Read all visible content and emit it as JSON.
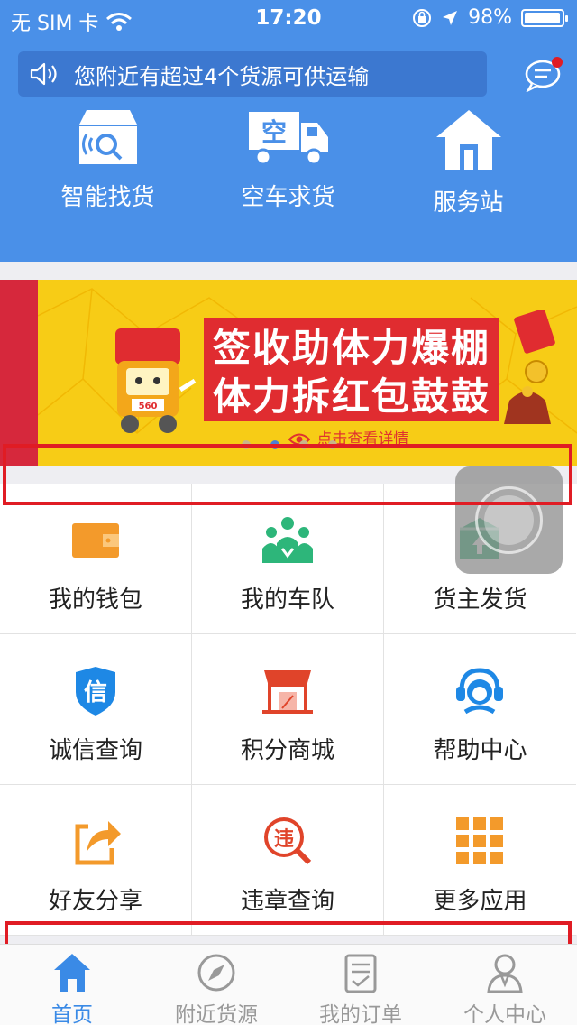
{
  "status_bar": {
    "carrier": "无 SIM 卡",
    "time": "17:20",
    "battery": "98%",
    "battery_level": 0.98
  },
  "notice": {
    "text": "您附近有超过4个货源可供运输"
  },
  "quick_actions": [
    {
      "label": "智能找货",
      "icon": "smart-find-cargo-icon"
    },
    {
      "label": "空车求货",
      "icon": "empty-truck-icon",
      "badge": "空"
    },
    {
      "label": "服务站",
      "icon": "service-station-icon"
    }
  ],
  "banner": {
    "line1": "签收助体力爆棚",
    "line2": "体力拆红包鼓鼓",
    "cta": "点击查看详情",
    "truck_badge": "560",
    "pages": 4,
    "active_page": 2
  },
  "grid": [
    {
      "label": "我的钱包",
      "icon": "wallet-icon"
    },
    {
      "label": "我的车队",
      "icon": "team-icon"
    },
    {
      "label": "货主发货",
      "icon": "ship-cargo-icon"
    },
    {
      "label": "诚信查询",
      "icon": "credit-check-icon",
      "glyph": "信"
    },
    {
      "label": "积分商城",
      "icon": "points-mall-icon"
    },
    {
      "label": "帮助中心",
      "icon": "help-center-icon"
    },
    {
      "label": "好友分享",
      "icon": "share-icon"
    },
    {
      "label": "违章查询",
      "icon": "violation-check-icon",
      "glyph": "违"
    },
    {
      "label": "更多应用",
      "icon": "more-apps-icon"
    }
  ],
  "tabbar": [
    {
      "label": "首页",
      "icon": "home-icon",
      "active": true
    },
    {
      "label": "附近货源",
      "icon": "compass-icon",
      "active": false
    },
    {
      "label": "我的订单",
      "icon": "order-icon",
      "active": false
    },
    {
      "label": "个人中心",
      "icon": "profile-icon",
      "active": false
    }
  ],
  "colors": {
    "primary": "#4a90e8",
    "accent": "#e01c24",
    "banner_yellow": "#f7cc16",
    "orange": "#f39a2b",
    "green": "#2db67a",
    "blue": "#1e88e5",
    "red": "#e0442a"
  }
}
